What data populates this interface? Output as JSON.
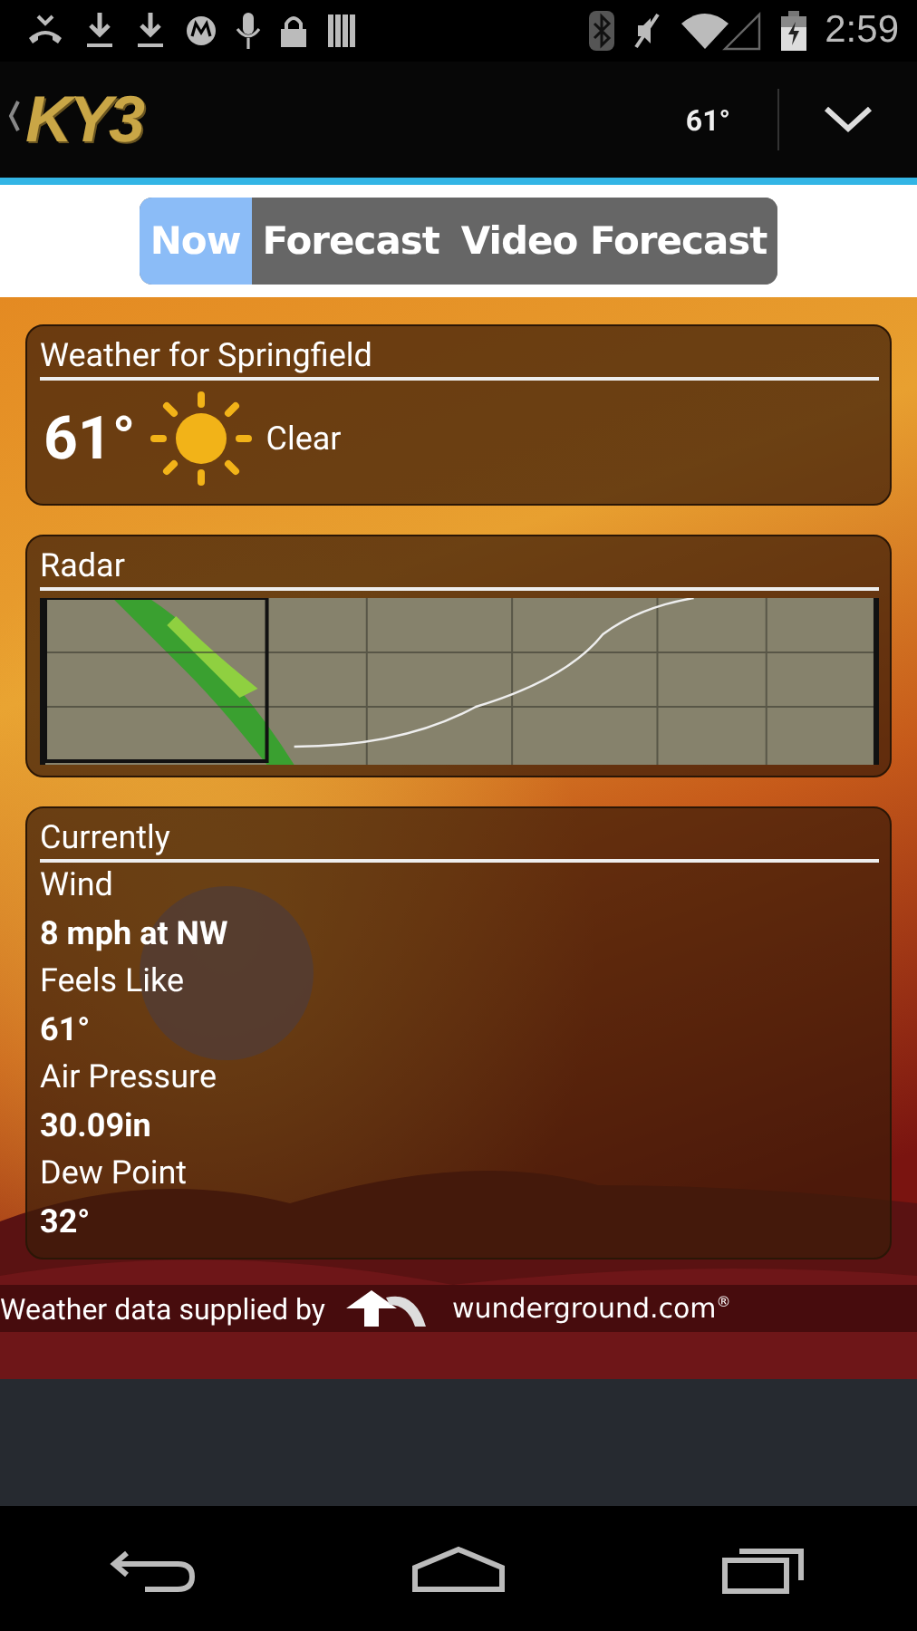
{
  "status_bar": {
    "time": "2:59"
  },
  "app_bar": {
    "logo": "KY3",
    "temperature": "61°"
  },
  "tabs": [
    {
      "label": "Now",
      "selected": true
    },
    {
      "label": "Forecast",
      "selected": false
    },
    {
      "label": "Video Forecast",
      "selected": false
    }
  ],
  "weather_card": {
    "title": "Weather for Springfield",
    "temperature": "61°",
    "condition": "Clear"
  },
  "radar_card": {
    "title": "Radar"
  },
  "currently_card": {
    "title": "Currently",
    "items": [
      {
        "label": "Wind",
        "value": "8 mph at NW"
      },
      {
        "label": "Feels Like",
        "value": "61°"
      },
      {
        "label": "Air Pressure",
        "value": "30.09in"
      },
      {
        "label": "Dew Point",
        "value": "32°"
      }
    ]
  },
  "credit": {
    "text": "Weather data supplied by",
    "logo": "wunderground.com$^{®}$"
  }
}
